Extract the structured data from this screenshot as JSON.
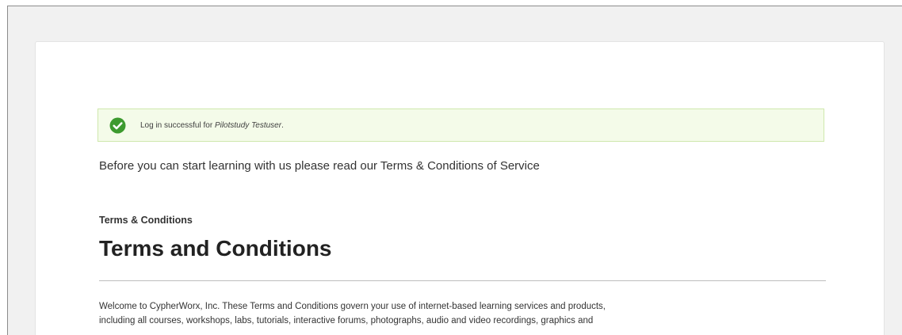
{
  "alert": {
    "icon": "check-circle-icon",
    "message_prefix": "Log in successful for ",
    "user_name": "Pilotstudy Testuser",
    "message_suffix": ".",
    "color": "#3d9a2f"
  },
  "intro_text": "Before you can start learning with us please read our Terms & Conditions of Service",
  "section_label": "Terms & Conditions",
  "document": {
    "title": "Terms and Conditions",
    "paragraph_line_1": "Welcome to CypherWorx, Inc. These Terms and Conditions govern your use of internet-based learning services and products,",
    "paragraph_line_2": "including all courses, workshops, labs, tutorials, interactive forums, photographs, audio and video recordings, graphics and"
  }
}
